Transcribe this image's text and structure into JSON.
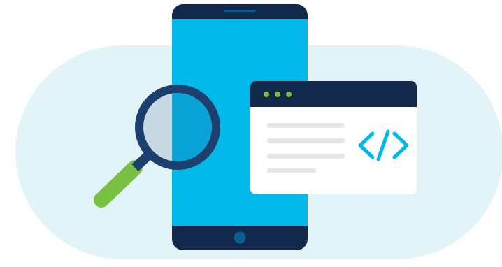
{
  "illustration": {
    "icons": {
      "background": "rounded-pill-backdrop",
      "device": "smartphone-icon",
      "browser": "browser-window-icon",
      "code": "code-brackets-icon",
      "magnifier": "magnifying-glass-icon"
    },
    "colors": {
      "backdrop": "#e3f4f9",
      "phone_frame": "#13294b",
      "phone_screen": "#00b9e8",
      "home_button": "#0a5e8d",
      "browser_bar": "#13294b",
      "browser_body": "#ffffff",
      "browser_dots": "#7ac143",
      "text_lines": "#e4e6e8",
      "code_symbol": "#00b9e8",
      "lens_rim": "#1d3f6e",
      "lens_glass_left": "#c7d9e2",
      "lens_glass_right": "#0aa3d6",
      "handle": "#7ac143"
    }
  }
}
